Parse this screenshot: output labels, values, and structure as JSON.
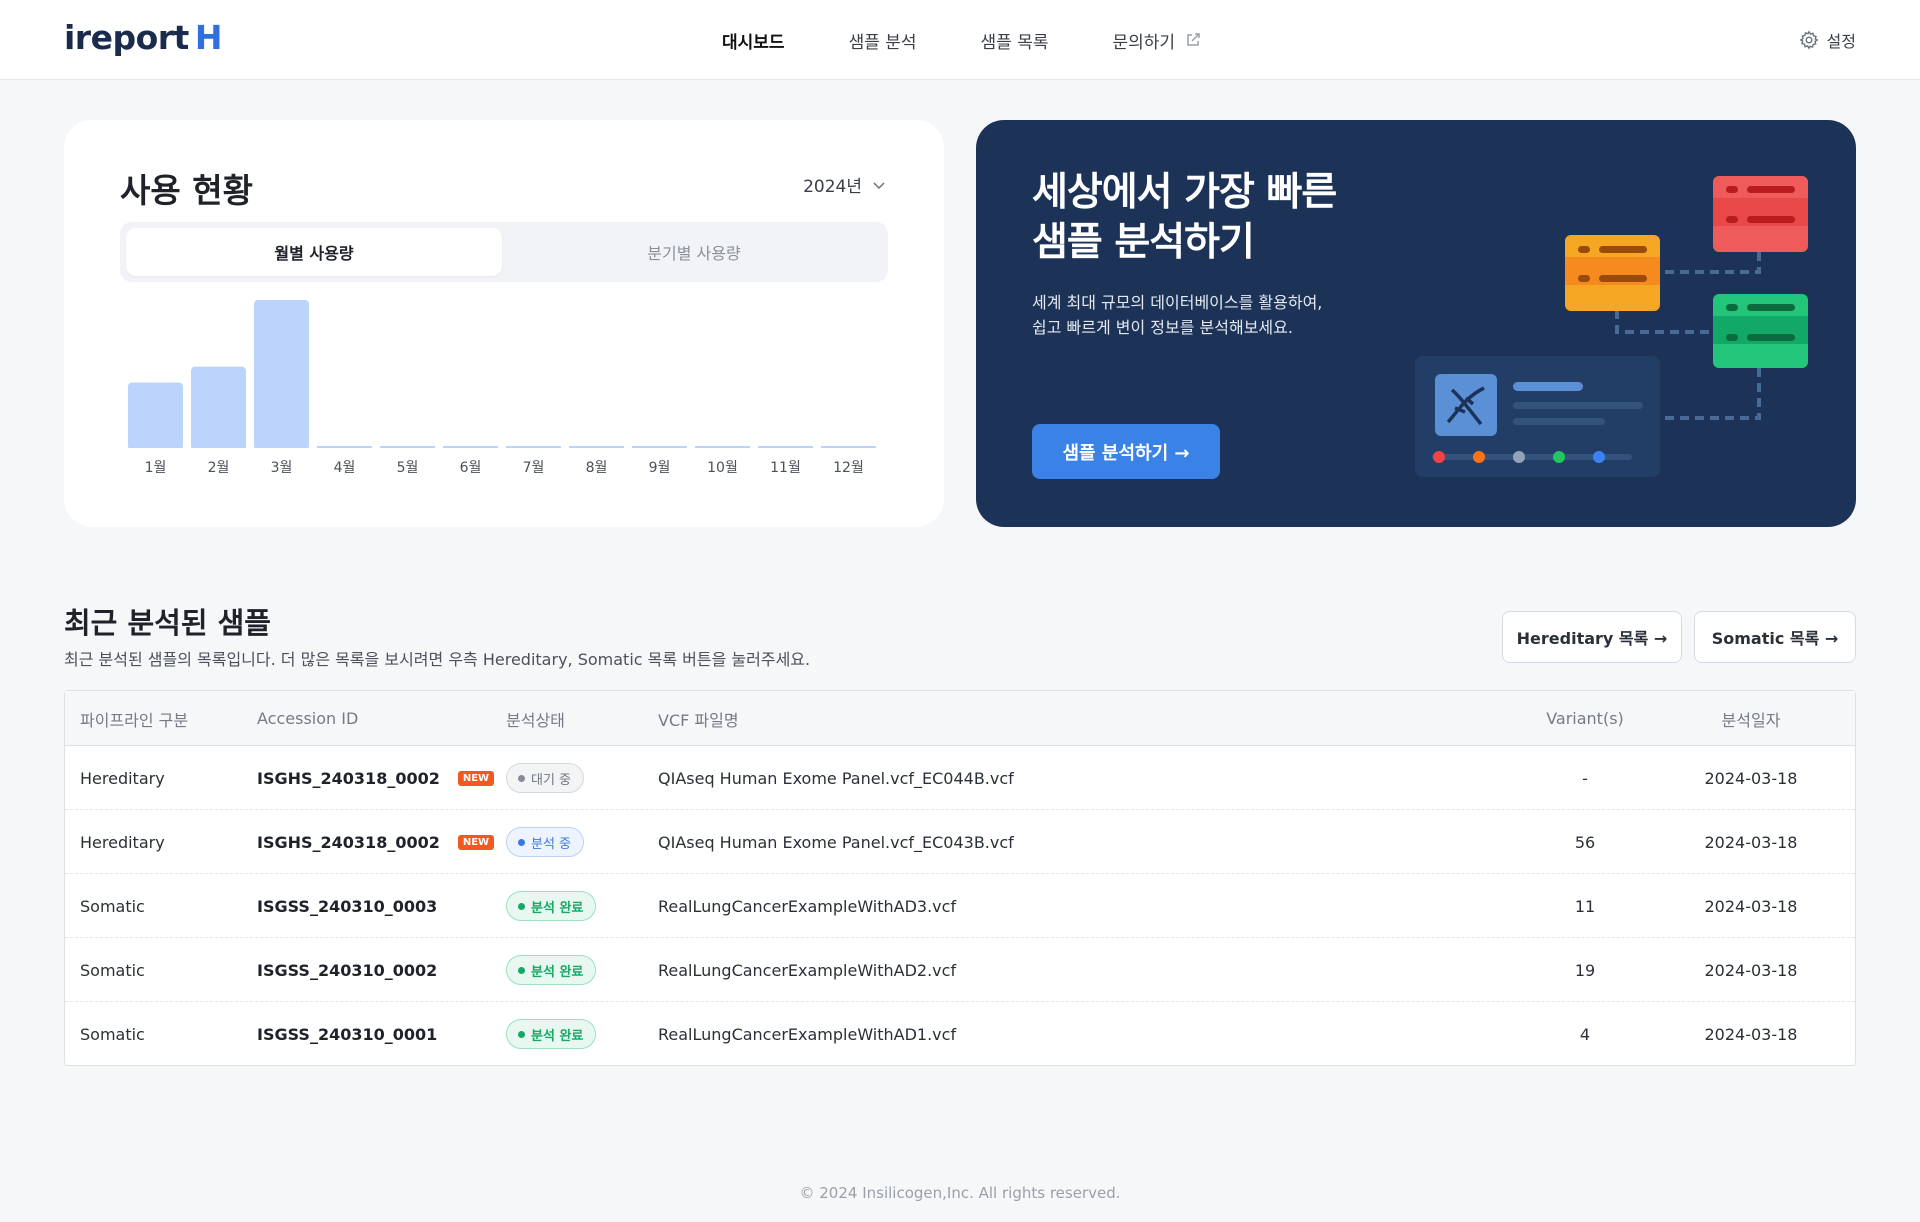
{
  "header": {
    "logo_text": "ireport",
    "logo_mark": "H",
    "nav": [
      {
        "label": "대시보드",
        "active": true
      },
      {
        "label": "샘플 분석",
        "active": false
      },
      {
        "label": "샘플 목록",
        "active": false
      },
      {
        "label": "문의하기",
        "active": false,
        "icon": "external-link-icon"
      }
    ],
    "settings_label": "설정",
    "settings_icon": "gear-icon"
  },
  "usage": {
    "title": "사용 현황",
    "year": "2024년",
    "tabs": [
      {
        "label": "월별 사용량",
        "active": true
      },
      {
        "label": "분기별 사용량",
        "active": false
      }
    ]
  },
  "chart_data": {
    "type": "bar",
    "categories": [
      "1월",
      "2월",
      "3월",
      "4월",
      "5월",
      "6월",
      "7월",
      "8월",
      "9월",
      "10월",
      "11월",
      "12월"
    ],
    "values": [
      10,
      12.5,
      23,
      0,
      0,
      0,
      0,
      0,
      0,
      0,
      0,
      0
    ],
    "title": "",
    "xlabel": "",
    "ylabel": "",
    "grid": false,
    "bar_color": "#bcd3fb"
  },
  "hero": {
    "title_line1": "세상에서 가장 빠른",
    "title_line2": "샘플 분석하기",
    "desc_line1": "세계 최대 규모의 데이터베이스를 활용하여,",
    "desc_line2": "쉽고 빠르게 변이 정보를 분석해보세요.",
    "button_label": "샘플 분석하기 →",
    "bg_color": "#1c3357",
    "button_color": "#3b82e6"
  },
  "recent": {
    "title": "최근 분석된 샘플",
    "desc": "최근 분석된 샘플의 목록입니다. 더 많은 목록을 보시려면 우측 Hereditary, Somatic 목록 버튼을 눌러주세요.",
    "hereditary_button": "Hereditary 목록 →",
    "somatic_button": "Somatic 목록 →"
  },
  "table": {
    "columns": [
      "파이프라인 구분",
      "Accession ID",
      "분석상태",
      "VCF 파일명",
      "Variant(s)",
      "분석일자"
    ],
    "new_badge": "NEW",
    "rows": [
      {
        "pipeline": "Hereditary",
        "accession": "ISGHS_240318_0002",
        "is_new": true,
        "status": "대기 중",
        "status_type": "wait",
        "vcf": "QIAseq Human Exome Panel.vcf_EC044B.vcf",
        "variants": "-",
        "date": "2024-03-18"
      },
      {
        "pipeline": "Hereditary",
        "accession": "ISGHS_240318_0002",
        "is_new": true,
        "status": "분석 중",
        "status_type": "run",
        "vcf": "QIAseq Human Exome Panel.vcf_EC043B.vcf",
        "variants": "56",
        "date": "2024-03-18"
      },
      {
        "pipeline": "Somatic",
        "accession": "ISGSS_240310_0003",
        "is_new": false,
        "status": "분석 완료",
        "status_type": "done",
        "vcf": "RealLungCancerExampleWithAD3.vcf",
        "variants": "11",
        "date": "2024-03-18"
      },
      {
        "pipeline": "Somatic",
        "accession": "ISGSS_240310_0002",
        "is_new": false,
        "status": "분석 완료",
        "status_type": "done",
        "vcf": "RealLungCancerExampleWithAD2.vcf",
        "variants": "19",
        "date": "2024-03-18"
      },
      {
        "pipeline": "Somatic",
        "accession": "ISGSS_240310_0001",
        "is_new": false,
        "status": "분석 완료",
        "status_type": "done",
        "vcf": "RealLungCancerExampleWithAD1.vcf",
        "variants": "4",
        "date": "2024-03-18"
      }
    ]
  },
  "footer": "© 2024 Insilicogen,Inc. All rights reserved."
}
